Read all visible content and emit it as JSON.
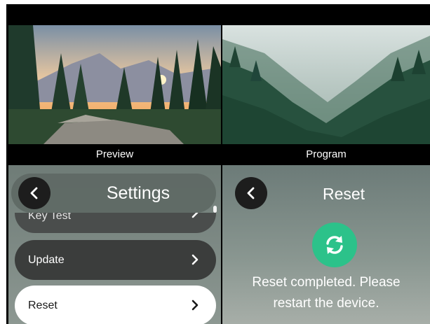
{
  "preview": {
    "caption": "Preview"
  },
  "program": {
    "caption": "Program"
  },
  "settings": {
    "title": "Settings",
    "items": [
      {
        "label": "Key Test"
      },
      {
        "label": "Update"
      },
      {
        "label": "Reset",
        "selected": true
      }
    ]
  },
  "reset_panel": {
    "title": "Reset",
    "message_line1": "Reset completed. Please",
    "message_line2": "restart the device."
  },
  "colors": {
    "accent": "#2cc28a",
    "selected_item": "#ffffff",
    "item_bg": "#3b3d3c"
  },
  "icons": [
    "back-chevron-icon",
    "chevron-right-icon",
    "refresh-icon"
  ]
}
